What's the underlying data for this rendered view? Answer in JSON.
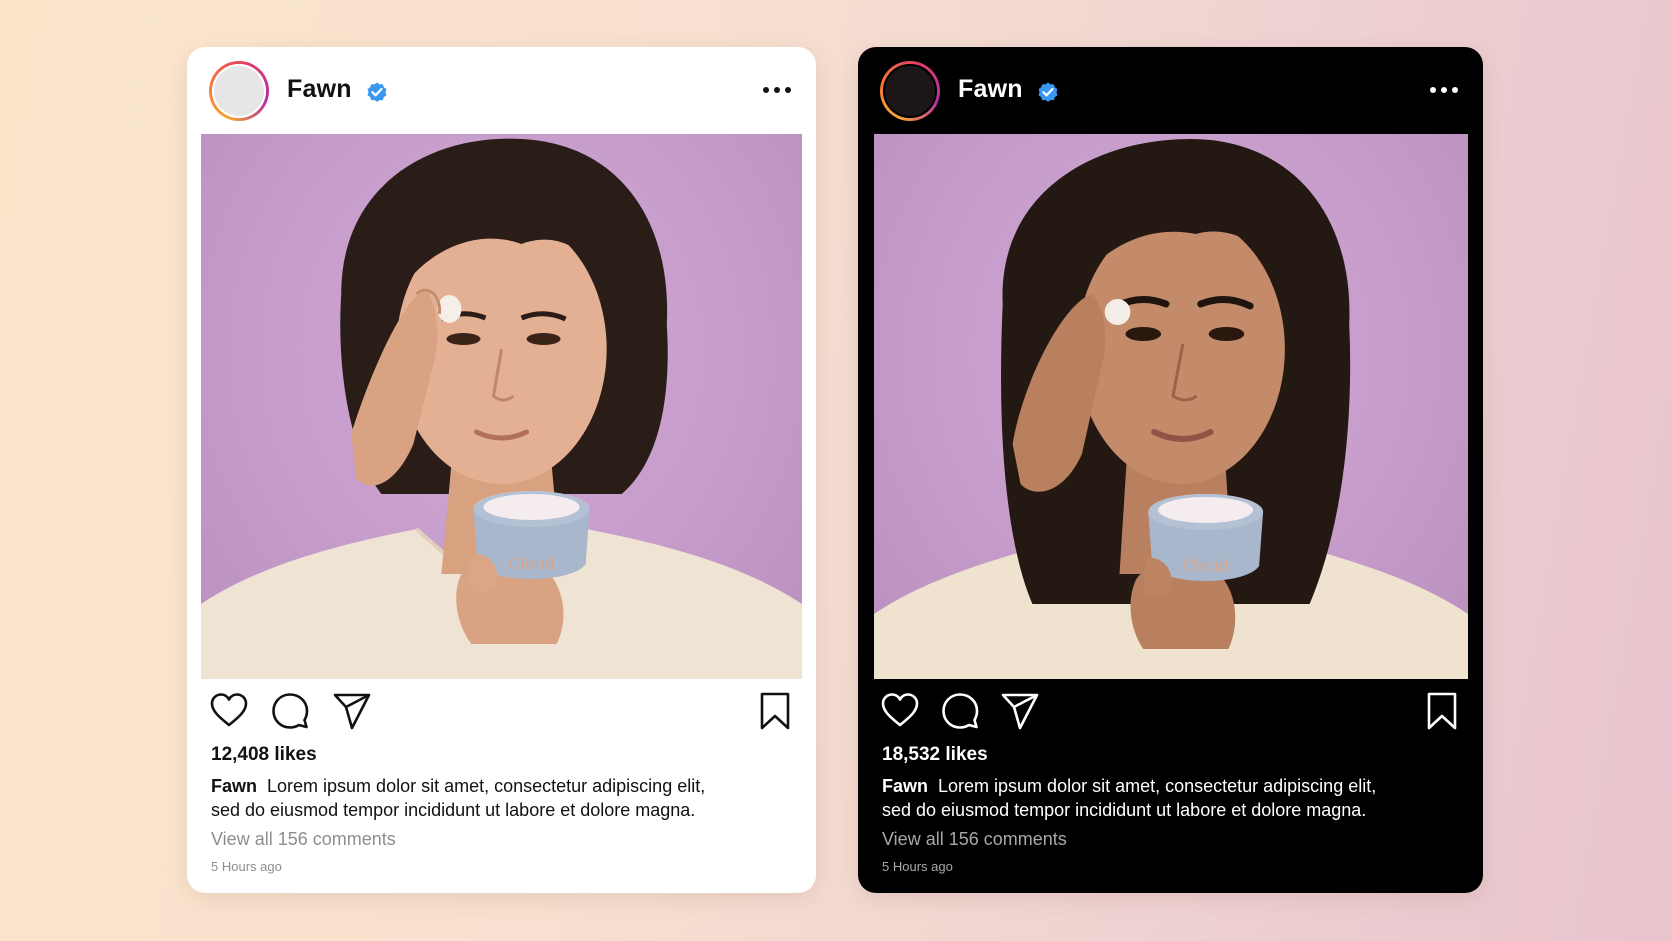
{
  "accent": {
    "verified": "#3897f0",
    "story_ring": [
      "#f7a531",
      "#e23b6b",
      "#b42fa6"
    ]
  },
  "posts": [
    {
      "theme": "light",
      "username": "Fawn",
      "verified_icon": "verified-badge-icon",
      "more_icon": "more-options-icon",
      "product_label": "Cloud",
      "likes": "12,408 likes",
      "caption_user": "Fawn",
      "caption_line1": "Lorem ipsum dolor sit amet, consectetur adipiscing elit,",
      "caption_line2": "sed do eiusmod tempor incididunt ut labore et dolore magna.",
      "comments": "View all 156 comments",
      "time": "5 Hours ago",
      "icons": [
        "heart-icon",
        "comment-icon",
        "share-icon",
        "bookmark-icon"
      ]
    },
    {
      "theme": "dark",
      "username": "Fawn",
      "verified_icon": "verified-badge-icon",
      "more_icon": "more-options-icon",
      "product_label": "Cloud",
      "likes": "18,532 likes",
      "caption_user": "Fawn",
      "caption_line1": "Lorem ipsum dolor sit amet, consectetur adipiscing elit,",
      "caption_line2": "sed do eiusmod tempor incididunt ut labore et dolore magna.",
      "comments": "View all 156 comments",
      "time": "5 Hours ago",
      "icons": [
        "heart-icon",
        "comment-icon",
        "share-icon",
        "bookmark-icon"
      ]
    }
  ]
}
